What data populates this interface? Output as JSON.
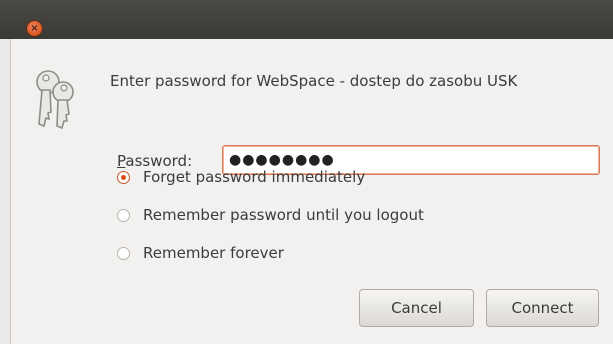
{
  "dialog": {
    "close_glyph": "×",
    "prompt": "Enter password for WebSpace - dostep do zasobu USK",
    "password_label": "Password:",
    "password_value": "●●●●●●●●",
    "options": [
      {
        "label": "Forget password immediately",
        "checked": true
      },
      {
        "label": "Remember password until you logout",
        "checked": false
      },
      {
        "label": "Remember forever",
        "checked": false
      }
    ],
    "cancel_label": "Cancel",
    "connect_label": "Connect"
  },
  "colors": {
    "accent": "#de4b12",
    "titlebar": "#3c3b37",
    "background": "#f2f1f0"
  },
  "icons": {
    "dialog_icon": "keys-icon",
    "close": "close-icon"
  }
}
